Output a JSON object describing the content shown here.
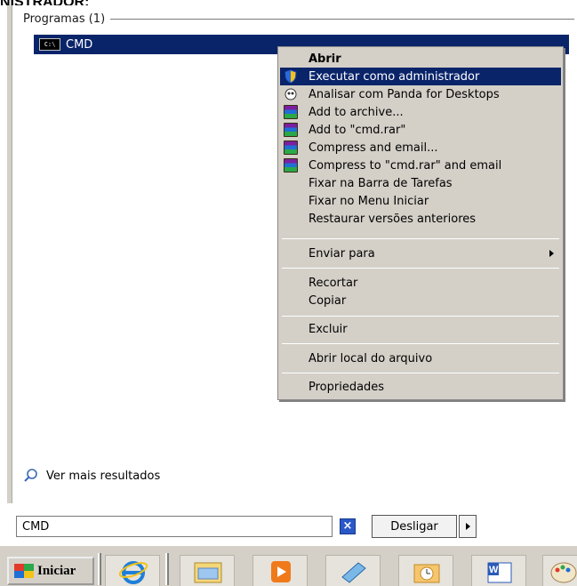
{
  "top_cut_text": "NISTRADOR:",
  "group_header": "Programas (1)",
  "program": {
    "label": "CMD",
    "icon": "cmd-icon"
  },
  "context_menu": {
    "items": [
      {
        "label": "Abrir",
        "bold": true,
        "icon": ""
      },
      {
        "label": "Executar como administrador",
        "highlighted": true,
        "icon": "shield-icon"
      },
      {
        "label": "Analisar com Panda for Desktops",
        "icon": "panda-icon"
      },
      {
        "label": "Add to archive...",
        "icon": "winrar-icon"
      },
      {
        "label": "Add to \"cmd.rar\"",
        "icon": "winrar-icon"
      },
      {
        "label": "Compress and email...",
        "icon": "winrar-icon"
      },
      {
        "label": "Compress to \"cmd.rar\" and email",
        "icon": "winrar-icon"
      },
      {
        "label": "Fixar na Barra de Tarefas",
        "icon": ""
      },
      {
        "label": "Fixar no Menu Iniciar",
        "icon": ""
      },
      {
        "label": "Restaurar versões anteriores",
        "icon": ""
      },
      {
        "label": "Enviar para",
        "icon": "",
        "submenu": true
      },
      {
        "label": "Recortar",
        "icon": ""
      },
      {
        "label": "Copiar",
        "icon": ""
      },
      {
        "label": "Excluir",
        "icon": ""
      },
      {
        "label": "Abrir local do arquivo",
        "icon": ""
      },
      {
        "label": "Propriedades",
        "icon": ""
      }
    ]
  },
  "more_results": "Ver mais resultados",
  "search": {
    "value": "CMD"
  },
  "shutdown_label": "Desligar",
  "taskbar": {
    "start_label": "Iniciar",
    "pinned": [
      "internet-explorer-icon",
      "windows-explorer-icon",
      "media-player-icon",
      "notepad-icon",
      "outlook-icon",
      "word-icon",
      "paint-icon"
    ]
  },
  "colors": {
    "highlight": "#0a246a",
    "menu_bg": "#d4d0c8"
  }
}
